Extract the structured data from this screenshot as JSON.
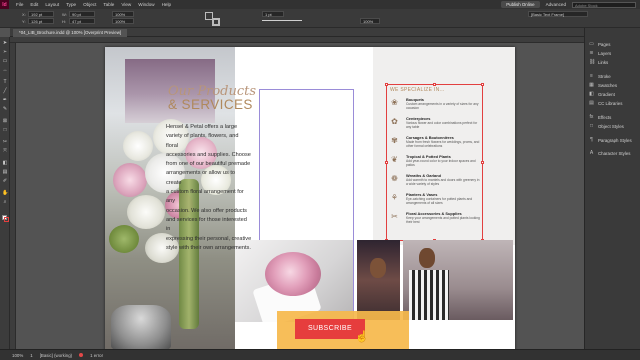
{
  "app": {
    "logo": "Id",
    "menus": [
      "File",
      "Edit",
      "Layout",
      "Type",
      "Object",
      "Table",
      "View",
      "Window",
      "Help"
    ],
    "publish_label": "Publish Online",
    "workspace": "Advanced",
    "search_placeholder": "Adobe Stock"
  },
  "controlbar": {
    "x": "192 pt",
    "y": "126 pt",
    "w": "90 pt",
    "h": "47 pt",
    "scale_x": "100%",
    "scale_y": "100%",
    "stroke_weight": "1 pt",
    "opacity": "100%",
    "frame_style": "[Basic Text Frame]"
  },
  "document": {
    "tab_title": "*04_LIB_Brochure.indd @ 100% [Overprint Preview]"
  },
  "content": {
    "heading_line1": "Our Products",
    "heading_line2": "& SERVICES",
    "body_lines": [
      "Hensel & Petal offers a large",
      "variety of plants, flowers, and floral",
      "accessories and supplies. Choose",
      "from one of our beautiful premade",
      "arrangements or allow us to create",
      "a custom floral arrangement for any",
      "occasion. We also offer products",
      "and services for those interested in",
      "expressing their personal, creative",
      "style with their own arrangements."
    ],
    "specialize_title": "WE SPECIALIZE IN...",
    "services": [
      {
        "icon": "bouquet-icon",
        "glyph": "❀",
        "name": "Bouquets",
        "desc": "Custom arrangements in a variety of sizes for any occasion"
      },
      {
        "icon": "centerpiece-icon",
        "glyph": "✿",
        "name": "Centerpieces",
        "desc": "Various flower and color combinations perfect for any table"
      },
      {
        "icon": "corsage-icon",
        "glyph": "✾",
        "name": "Corsages & Boutonnières",
        "desc": "Made from fresh flowers for weddings, proms, and other formal celebrations"
      },
      {
        "icon": "plant-icon",
        "glyph": "❦",
        "name": "Tropical & Potted Plants",
        "desc": "Add year-round color to your indoor spaces and patios"
      },
      {
        "icon": "wreath-icon",
        "glyph": "❁",
        "name": "Wreaths & Garland",
        "desc": "Add warmth to mantels and doors with greenery in a wide variety of styles"
      },
      {
        "icon": "vase-icon",
        "glyph": "⚘",
        "name": "Planters & Vases",
        "desc": "Eye-catching containers for potted plants and arrangements of all sizes"
      },
      {
        "icon": "supplies-icon",
        "glyph": "✂",
        "name": "Floral Accessories & Supplies",
        "desc": "Keep your arrangements and potted plants looking their best"
      }
    ],
    "subscribe_label": "SUBSCRIBE"
  },
  "panels": [
    {
      "icon": "pages-icon",
      "glyph": "▭",
      "label": "Pages"
    },
    {
      "icon": "layers-icon",
      "glyph": "≋",
      "label": "Layers"
    },
    {
      "icon": "links-icon",
      "glyph": "⛓",
      "label": "Links"
    },
    {
      "icon": "stroke-icon",
      "glyph": "≡",
      "label": "Stroke"
    },
    {
      "icon": "swatches-icon",
      "glyph": "▦",
      "label": "Swatches"
    },
    {
      "icon": "gradient-icon",
      "glyph": "◧",
      "label": "Gradient"
    },
    {
      "icon": "cc-libraries-icon",
      "glyph": "▤",
      "label": "CC Libraries"
    },
    {
      "icon": "effects-icon",
      "glyph": "fx",
      "label": "Effects"
    },
    {
      "icon": "object-styles-icon",
      "glyph": "□",
      "label": "Object Styles"
    },
    {
      "icon": "paragraph-styles-icon",
      "glyph": "¶",
      "label": "Paragraph Styles"
    },
    {
      "icon": "character-styles-icon",
      "glyph": "A",
      "label": "Character Styles"
    }
  ],
  "status": {
    "zoom": "100%",
    "page": "1",
    "style": "[Basic] (working)",
    "preflight": "1 error"
  },
  "colors": {
    "accent_heading": "#b0895d",
    "subscribe_button": "#e63d3d",
    "cta_bar": "#f6b84b",
    "selection_frame": "#e23f3f"
  }
}
